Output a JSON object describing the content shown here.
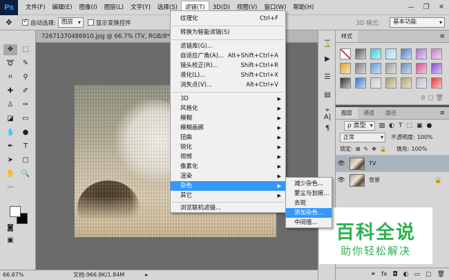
{
  "app": {
    "logo": "Ps"
  },
  "menubar": {
    "items": [
      "文件(F)",
      "编辑(E)",
      "图像(I)",
      "图层(L)",
      "文字(Y)",
      "选择(S)",
      "滤镜(T)",
      "3D(D)",
      "视图(V)",
      "窗口(W)",
      "帮助(H)"
    ],
    "active_index": 6
  },
  "window_controls": [
    "—",
    "❐",
    "✕"
  ],
  "options_bar": {
    "auto_select_label": "自动选择:",
    "auto_select_checked": true,
    "auto_select_value": "图层",
    "show_transform_label": "显示变换控件",
    "mode_3d_label": "3D 模式:",
    "workspace": "基本功能"
  },
  "document": {
    "tab_title": "72671370486910.jpg @ 66.7% (TV, RGB/8*)",
    "zoom": "66.67%",
    "doc_info": "文档:966.8K/1.84M"
  },
  "filter_menu": {
    "top_items": [
      {
        "label": "纹理化",
        "shortcut": "Ctrl+F"
      },
      {
        "label": "转换为智能滤镜(S)",
        "shortcut": ""
      }
    ],
    "mid_items": [
      {
        "label": "滤镜库(G)...",
        "shortcut": ""
      },
      {
        "label": "自适应广角(A)...",
        "shortcut": "Alt+Shift+Ctrl+A"
      },
      {
        "label": "镜头校正(R)...",
        "shortcut": "Shift+Ctrl+R"
      },
      {
        "label": "液化(L)...",
        "shortcut": "Shift+Ctrl+X"
      },
      {
        "label": "消失点(V)...",
        "shortcut": "Alt+Ctrl+V"
      }
    ],
    "sub_items": [
      "3D",
      "风格化",
      "模糊",
      "模糊画廊",
      "扭曲",
      "锐化",
      "视频",
      "像素化",
      "渲染",
      "杂色",
      "其它"
    ],
    "highlighted_sub": "杂色",
    "browse_item": "浏览联机滤镜..."
  },
  "noise_submenu": {
    "items": [
      "减少杂色...",
      "蒙尘与划痕...",
      "去斑",
      "添加杂色...",
      "中间值..."
    ],
    "highlighted": "添加杂色..."
  },
  "styles_panel": {
    "tab": "样式",
    "swatch_colors": [
      "#ffffff",
      "#555555",
      "#37c8e8",
      "#9ad8ef",
      "#3f7fc7",
      "#b06ed8",
      "#c67cc2",
      "#e8a020",
      "#7a7a7a",
      "#5a9ad8",
      "#9a9a9a",
      "#6a8ab8",
      "#d84890",
      "#8848c8",
      "#303030",
      "#3a78c8",
      "#c8c8c8",
      "#a89a70",
      "#b0a070",
      "#b8b8c8",
      "#e83838"
    ]
  },
  "layers_panel": {
    "tabs": [
      "图层",
      "通道",
      "路径"
    ],
    "filter_kind": "ρ 类型",
    "blend_mode": "正常",
    "opacity_label": "不透明度:",
    "opacity_value": "100%",
    "lock_label": "锁定:",
    "fill_label": "填充:",
    "fill_value": "100%",
    "layers": [
      {
        "name": "TV",
        "selected": true,
        "locked": false
      },
      {
        "name": "背景",
        "selected": false,
        "locked": true
      }
    ]
  },
  "watermark": {
    "title": "百科全说",
    "subtitle": "助你轻松解决"
  }
}
